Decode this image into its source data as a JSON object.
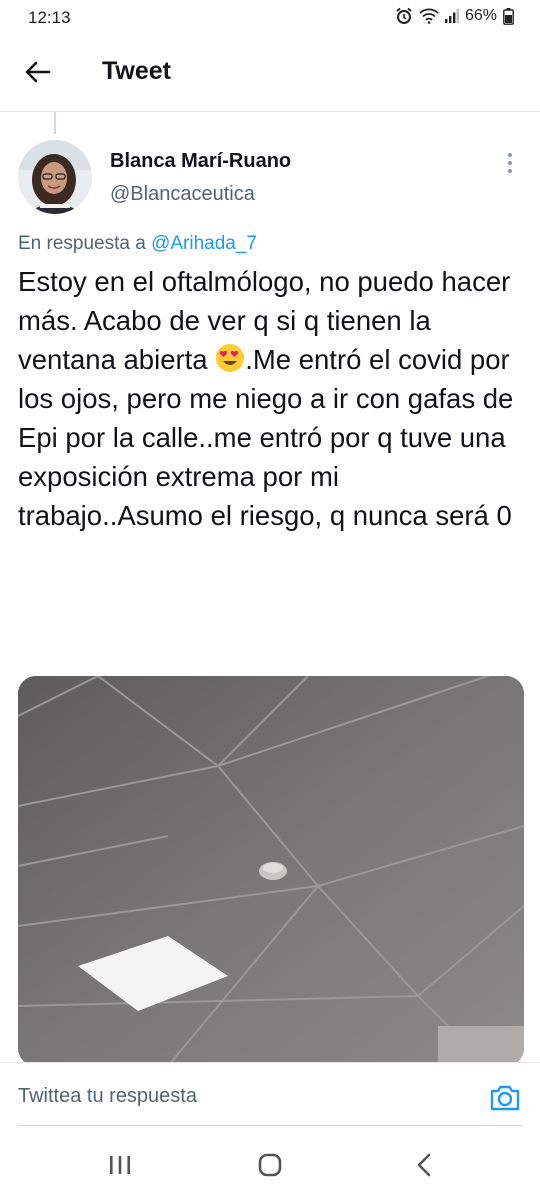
{
  "status_bar": {
    "time": "12:13",
    "battery": "66%"
  },
  "header": {
    "title": "Tweet",
    "back_icon": "arrow-left-icon"
  },
  "tweet": {
    "author_name": "Blanca Marí-Ruano",
    "author_handle": "@Blancaceutica",
    "reply_prefix": "En respuesta a ",
    "reply_handle": "@Arihada_7",
    "text_part1": "Estoy en el oftalmólogo, no puedo hacer más. Acabo de ver q si q tienen la ventana abierta ",
    "emoji": "smiling-face-with-heart-eyes",
    "text_part2": ".Me entró el covid por los ojos, pero me niego a ir con gafas de Epi por la calle..me entró por q tuve una exposición extrema por mi trabajo..Asumo el riesgo, q nunca será 0",
    "media_description_icon": "photo"
  },
  "reply_bar": {
    "placeholder": "Twittea tu respuesta",
    "camera_icon": "camera-icon"
  },
  "colors": {
    "accent": "#1d9bf0",
    "text": "#0f1419",
    "secondary": "#536471"
  }
}
